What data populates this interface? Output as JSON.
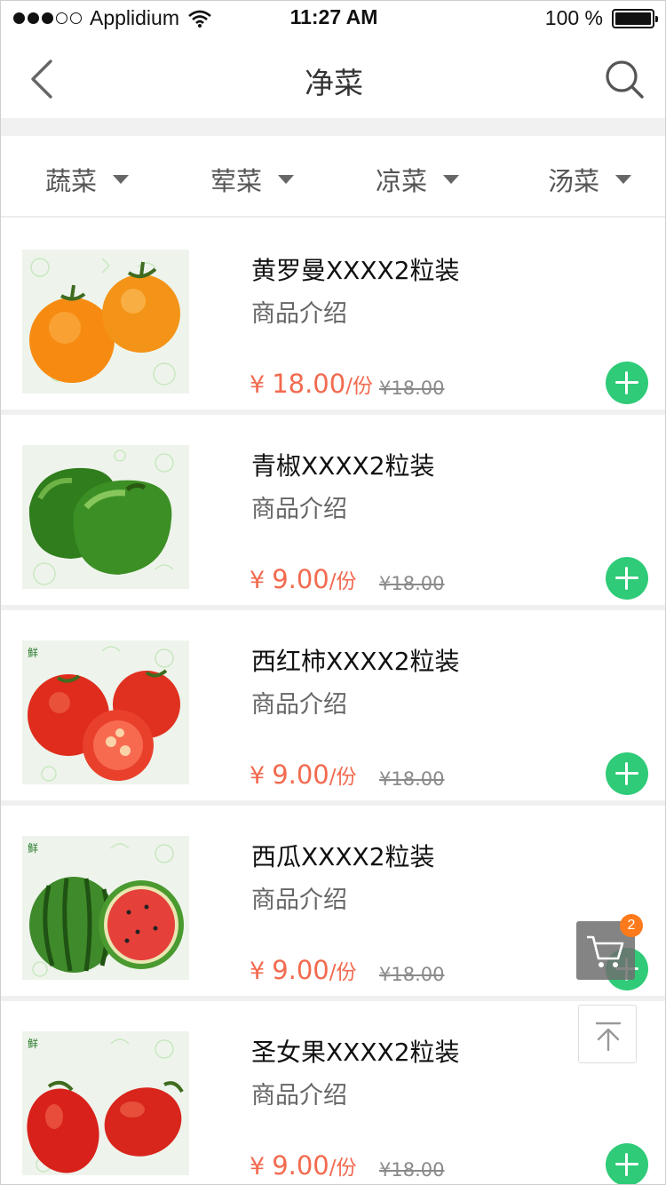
{
  "status_bar": {
    "carrier": "Applidium",
    "time": "11:27 AM",
    "battery": "100 %"
  },
  "nav": {
    "title": "净菜",
    "back_icon": "chevron-left-icon",
    "search_icon": "search-icon"
  },
  "filters": [
    {
      "label": "蔬菜"
    },
    {
      "label": "荤菜"
    },
    {
      "label": "凉菜"
    },
    {
      "label": "汤菜"
    }
  ],
  "products": [
    {
      "name": "黄罗曼XXXX2粒装",
      "desc": "商品介绍",
      "currency": "¥",
      "price": "18.00",
      "unit": "/份",
      "old_price": "¥18.00",
      "image": "orange-tomato"
    },
    {
      "name": "青椒XXXX2粒装",
      "desc": "商品介绍",
      "currency": "¥",
      "price": "9.00",
      "unit": "/份",
      "old_price": "¥18.00",
      "image": "green-pepper"
    },
    {
      "name": "西红柿XXXX2粒装",
      "desc": "商品介绍",
      "currency": "¥",
      "price": "9.00",
      "unit": "/份",
      "old_price": "¥18.00",
      "image": "red-tomato"
    },
    {
      "name": "西瓜XXXX2粒装",
      "desc": "商品介绍",
      "currency": "¥",
      "price": "9.00",
      "unit": "/份",
      "old_price": "¥18.00",
      "image": "watermelon"
    },
    {
      "name": "圣女果XXXX2粒装",
      "desc": "商品介绍",
      "currency": "¥",
      "price": "9.00",
      "unit": "/份",
      "old_price": "¥18.00",
      "image": "cherry-tomato"
    }
  ],
  "cart": {
    "count": "2",
    "icon": "cart-icon"
  },
  "scroll_top": {
    "icon": "arrow-up-to-top-icon"
  },
  "colors": {
    "price": "#f26a4f",
    "accent": "#2fcb78",
    "badge": "#ff7a1a"
  }
}
